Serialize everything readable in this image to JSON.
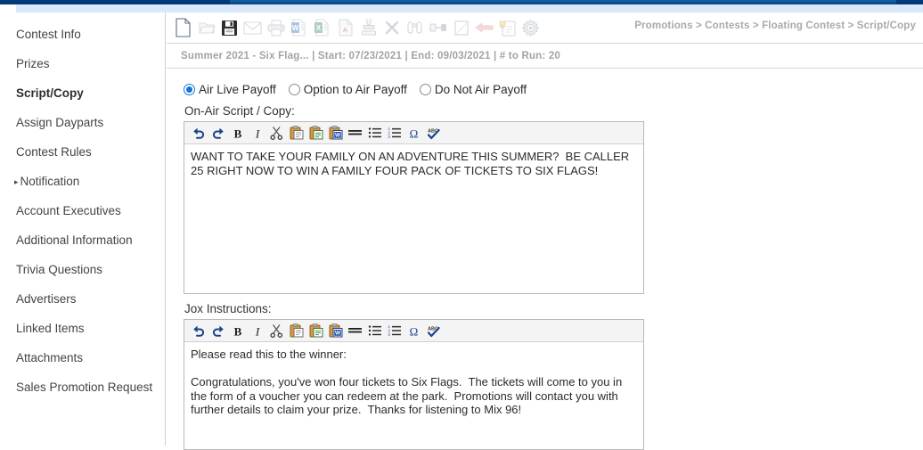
{
  "colors": {
    "chrome_navy": "#003a78",
    "chrome_pale_blue": "#dbe8fb",
    "accent_blue": "#1675d1",
    "breadcrumb_gray": "#a9a9a9",
    "info_gray": "#a3a3a3",
    "toolbar_bg": "#f4f4f4",
    "border_gray": "#b9b9b9"
  },
  "sidebar": {
    "items": [
      {
        "label": "Contest Info",
        "active": false,
        "has_arrow": false
      },
      {
        "label": "Prizes",
        "active": false,
        "has_arrow": false
      },
      {
        "label": "Script/Copy",
        "active": true,
        "has_arrow": false
      },
      {
        "label": "Assign Dayparts",
        "active": false,
        "has_arrow": false
      },
      {
        "label": "Contest Rules",
        "active": false,
        "has_arrow": false
      },
      {
        "label": "Notification",
        "active": false,
        "has_arrow": true
      },
      {
        "label": "Account Executives",
        "active": false,
        "has_arrow": false
      },
      {
        "label": "Additional Information",
        "active": false,
        "has_arrow": false
      },
      {
        "label": "Trivia Questions",
        "active": false,
        "has_arrow": false
      },
      {
        "label": "Advertisers",
        "active": false,
        "has_arrow": false
      },
      {
        "label": "Linked Items",
        "active": false,
        "has_arrow": false
      },
      {
        "label": "Attachments",
        "active": false,
        "has_arrow": false
      },
      {
        "label": "Sales Promotion Request",
        "active": false,
        "has_arrow": false
      }
    ],
    "expand_arrow_glyph": "▸"
  },
  "toolbar": {
    "buttons": [
      {
        "icon": "new-document-icon",
        "title": "New",
        "enabled": true
      },
      {
        "icon": "open-folder-icon",
        "title": "Open",
        "enabled": false
      },
      {
        "icon": "save-disk-icon",
        "title": "Save",
        "enabled": true
      },
      {
        "icon": "email-envelope-icon",
        "title": "Email",
        "enabled": false
      },
      {
        "icon": "print-icon",
        "title": "Print",
        "enabled": false
      },
      {
        "icon": "export-word-icon",
        "title": "Export to Word",
        "enabled": false
      },
      {
        "icon": "export-excel-icon",
        "title": "Export to Excel",
        "enabled": false
      },
      {
        "icon": "export-pdf-icon",
        "title": "Export to PDF",
        "enabled": false
      },
      {
        "icon": "stamp-icon",
        "title": "Stamp",
        "enabled": false
      },
      {
        "icon": "delete-x-icon",
        "title": "Delete",
        "enabled": false
      },
      {
        "icon": "binoculars-icon",
        "title": "Find",
        "enabled": false
      },
      {
        "icon": "link-nodes-icon",
        "title": "Link",
        "enabled": false
      },
      {
        "icon": "notepad-icon",
        "title": "Notes",
        "enabled": false
      },
      {
        "icon": "back-arrow-icon",
        "title": "Back",
        "enabled": false
      },
      {
        "icon": "clipboard-award-icon",
        "title": "Report",
        "enabled": false
      },
      {
        "icon": "gear-settings-icon",
        "title": "Settings",
        "enabled": false
      }
    ]
  },
  "breadcrumb": {
    "text": "Promotions > Contests > Floating Contest > Script/Copy",
    "parts": [
      "Promotions",
      "Contests",
      "Floating Contest",
      "Script/Copy"
    ]
  },
  "info_strip": {
    "text": "Summer 2021 - Six Flag...   |   Start: 07/23/2021   |   End: 09/03/2021   |   # to Run: 20",
    "contest_name": "Summer 2021 - Six Flag...",
    "start_label": "Start:",
    "start_date": "07/23/2021",
    "end_label": "End:",
    "end_date": "09/03/2021",
    "run_label": "# to Run:",
    "run_count": "20"
  },
  "payoff": {
    "options": [
      {
        "label": "Air Live Payoff",
        "selected": true
      },
      {
        "label": "Option to Air Payoff",
        "selected": false
      },
      {
        "label": "Do Not Air Payoff",
        "selected": false
      }
    ]
  },
  "script_field": {
    "label": "On-Air Script / Copy:",
    "value": "WANT TO TAKE YOUR FAMILY ON AN ADVENTURE THIS SUMMER?  BE CALLER 25 RIGHT NOW TO WIN A FAMILY FOUR PACK OF TICKETS TO SIX FLAGS!"
  },
  "jox_field": {
    "label": "Jox Instructions:",
    "value": "Please read this to the winner:\n\nCongratulations, you've won four tickets to Six Flags.  The tickets will come to you in the form of a voucher you can redeem at the park.  Promotions will contact you with further details to claim your prize.  Thanks for listening to Mix 96!"
  },
  "editor_toolbar": {
    "buttons": [
      {
        "icon": "undo-icon",
        "title": "Undo"
      },
      {
        "icon": "redo-icon",
        "title": "Redo"
      },
      {
        "icon": "bold-icon",
        "title": "Bold",
        "glyph": "B"
      },
      {
        "icon": "italic-icon",
        "title": "Italic",
        "glyph": "I"
      },
      {
        "icon": "cut-scissors-icon",
        "title": "Cut"
      },
      {
        "icon": "paste-icon",
        "title": "Paste"
      },
      {
        "icon": "paste-text-icon",
        "title": "Paste as plain text"
      },
      {
        "icon": "paste-word-icon",
        "title": "Paste from Word",
        "glyph": "W"
      },
      {
        "icon": "horizontal-rule-icon",
        "title": "Horizontal rule"
      },
      {
        "icon": "bullet-list-icon",
        "title": "Bulleted list"
      },
      {
        "icon": "numbered-list-icon",
        "title": "Numbered list"
      },
      {
        "icon": "special-char-icon",
        "title": "Insert special character",
        "glyph": "Ω"
      },
      {
        "icon": "spellcheck-icon",
        "title": "Spell check",
        "glyph": "ABC"
      }
    ]
  }
}
